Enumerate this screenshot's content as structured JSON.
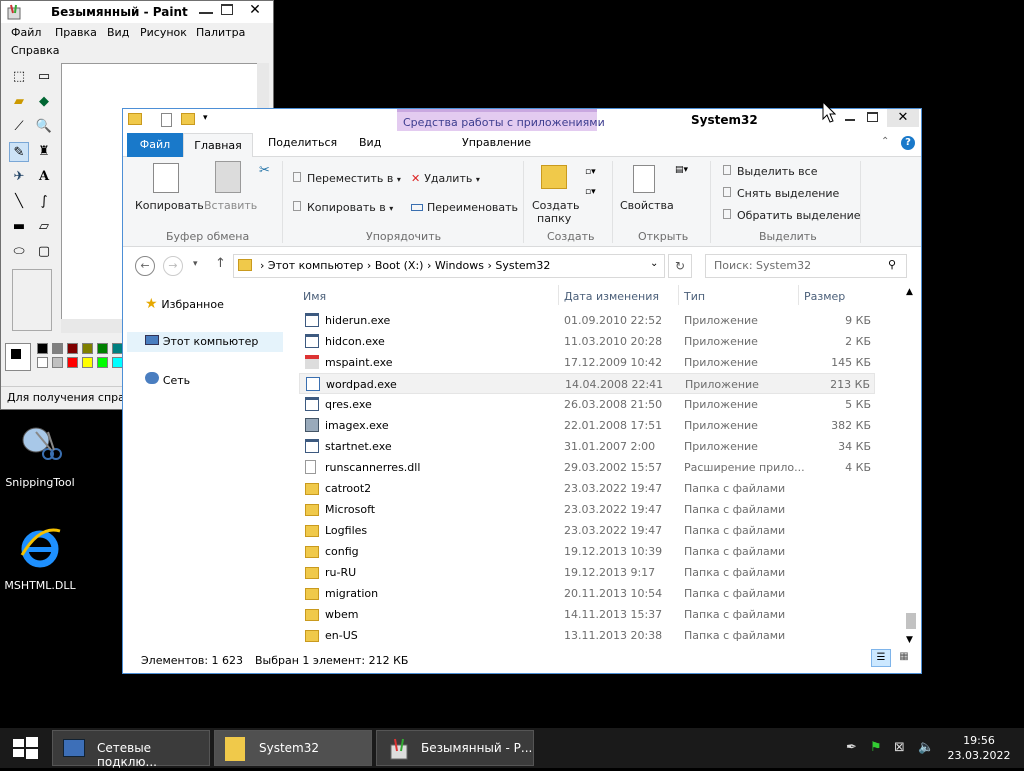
{
  "paint": {
    "title": "Безымянный - Paint",
    "menu": [
      "Файл",
      "Правка",
      "Вид",
      "Рисунок",
      "Палитра",
      "Справка"
    ],
    "status": "Для получения справк",
    "palette": [
      "#000000",
      "#808080",
      "#800000",
      "#808000",
      "#008000",
      "#008080",
      "#000080",
      "#800080",
      "#808040",
      "#004040",
      "#ffffff",
      "#c0c0c0",
      "#ff0000",
      "#ffff00",
      "#00ff00",
      "#00ffff",
      "#0000ff",
      "#ff00ff",
      "#ffff80",
      "#00ff80"
    ]
  },
  "explorer": {
    "title": "System32",
    "context_tab": "Средства работы с приложениями",
    "context_sub": "Управление",
    "tabs": {
      "file": "Файл",
      "home": "Главная",
      "share": "Поделиться",
      "view": "Вид"
    },
    "ribbon": {
      "copy": "Копировать",
      "paste": "Вставить",
      "clipboard": "Буфер обмена",
      "move_to": "Переместить в",
      "copy_to": "Копировать в",
      "delete": "Удалить",
      "rename": "Переименовать",
      "organize": "Упорядочить",
      "new_folder_1": "Создать",
      "new_folder_2": "папку",
      "new": "Создать",
      "properties": "Свойства",
      "open": "Открыть",
      "select_all": "Выделить все",
      "select_none": "Снять выделение",
      "invert": "Обратить выделение",
      "select": "Выделить"
    },
    "breadcrumb": [
      "Этот компьютер",
      "Boot (X:)",
      "Windows",
      "System32"
    ],
    "search_placeholder": "Поиск: System32",
    "nav": {
      "favorites": "Избранное",
      "computer": "Этот компьютер",
      "network": "Сеть"
    },
    "columns": {
      "name": "Имя",
      "date": "Дата изменения",
      "type": "Тип",
      "size": "Размер"
    },
    "files": [
      {
        "name": "hiderun.exe",
        "date": "01.09.2010 22:52",
        "type": "Приложение",
        "size": "9 КБ",
        "icon": "app"
      },
      {
        "name": "hidcon.exe",
        "date": "11.03.2010 20:28",
        "type": "Приложение",
        "size": "2 КБ",
        "icon": "app"
      },
      {
        "name": "mspaint.exe",
        "date": "17.12.2009 10:42",
        "type": "Приложение",
        "size": "145 КБ",
        "icon": "paint"
      },
      {
        "name": "wordpad.exe",
        "date": "14.04.2008 22:41",
        "type": "Приложение",
        "size": "213 КБ",
        "icon": "wordpad"
      },
      {
        "name": "qres.exe",
        "date": "26.03.2008 21:50",
        "type": "Приложение",
        "size": "5 КБ",
        "icon": "app"
      },
      {
        "name": "imagex.exe",
        "date": "22.01.2008 17:51",
        "type": "Приложение",
        "size": "382 КБ",
        "icon": "imagex"
      },
      {
        "name": "startnet.exe",
        "date": "31.01.2007 2:00",
        "type": "Приложение",
        "size": "34 КБ",
        "icon": "app"
      },
      {
        "name": "runscannerres.dll",
        "date": "29.03.2002 15:57",
        "type": "Расширение прило...",
        "size": "4 КБ",
        "icon": "dll"
      },
      {
        "name": "catroot2",
        "date": "23.03.2022 19:47",
        "type": "Папка с файлами",
        "size": "",
        "icon": "folder"
      },
      {
        "name": "Microsoft",
        "date": "23.03.2022 19:47",
        "type": "Папка с файлами",
        "size": "",
        "icon": "folder"
      },
      {
        "name": "Logfiles",
        "date": "23.03.2022 19:47",
        "type": "Папка с файлами",
        "size": "",
        "icon": "folder"
      },
      {
        "name": "config",
        "date": "19.12.2013 10:39",
        "type": "Папка с файлами",
        "size": "",
        "icon": "folder"
      },
      {
        "name": "ru-RU",
        "date": "19.12.2013 9:17",
        "type": "Папка с файлами",
        "size": "",
        "icon": "folder"
      },
      {
        "name": "migration",
        "date": "20.11.2013 10:54",
        "type": "Папка с файлами",
        "size": "",
        "icon": "folder"
      },
      {
        "name": "wbem",
        "date": "14.11.2013 15:37",
        "type": "Папка с файлами",
        "size": "",
        "icon": "folder"
      },
      {
        "name": "en-US",
        "date": "13.11.2013 20:38",
        "type": "Папка с файлами",
        "size": "",
        "icon": "folder"
      }
    ],
    "status_count": "Элементов: 1 623",
    "status_selected": "Выбран 1 элемент: 212 КБ"
  },
  "desktop": {
    "snipping": "SnippingTool",
    "mshtml": "MSHTML.DLL"
  },
  "taskbar": {
    "network": "Сетевые подклю...",
    "system32": "System32",
    "paint": "Безымянный - Р...",
    "time": "19:56",
    "date": "23.03.2022"
  }
}
